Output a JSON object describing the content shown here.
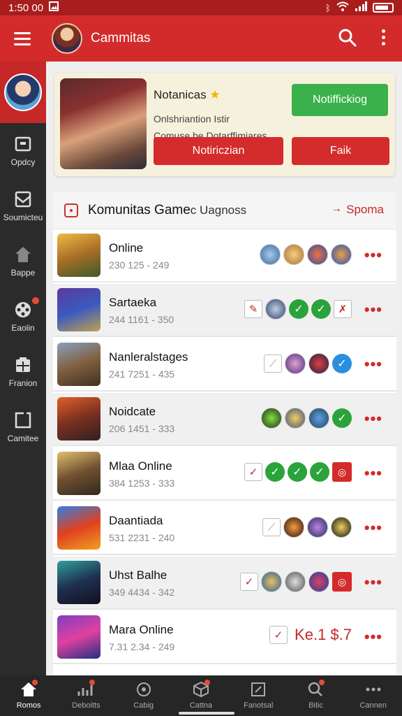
{
  "status": {
    "time": "1:50 00"
  },
  "appbar": {
    "title": "Cammitas"
  },
  "rail": [
    {
      "label": "Opdcy",
      "icon": "inbox-icon"
    },
    {
      "label": "Soumicteu",
      "icon": "envelope-icon"
    },
    {
      "label": "Bappe",
      "icon": "home-icon"
    },
    {
      "label": "Eaolin",
      "icon": "film-reel-icon"
    },
    {
      "label": "Franion",
      "icon": "grid-icon"
    },
    {
      "label": "Camitee",
      "icon": "square-icon"
    }
  ],
  "notification": {
    "title": "Notanicas",
    "line1": "Onlshriantion Istir",
    "line2": "Comuse be Dotarffimiares.",
    "primary_button": "Notiffickiog",
    "secondary_button": "Notiriczian",
    "tertiary_button": "Faik"
  },
  "community": {
    "title": "Komunitas Game",
    "subtitle": "c Uagnoss",
    "arrow": "→",
    "link": "Spoma"
  },
  "games": [
    {
      "name": "Online",
      "stats": "230 125 - 249"
    },
    {
      "name": "Sartaeka",
      "stats": "244 1161 - 350"
    },
    {
      "name": "Nanleralstages",
      "stats": "241 7251 - 435"
    },
    {
      "name": "Noidcate",
      "stats": "206 1451 - 333"
    },
    {
      "name": "Mlaa Online",
      "stats": "384 1253 - 333"
    },
    {
      "name": "Daantiada",
      "stats": "531 2231 - 240"
    },
    {
      "name": "Uhst Balhe",
      "stats": "349 4434 - 342"
    },
    {
      "name": "Mara Online",
      "stats": "7.31 2.34 - 249",
      "badge": "Ke.1 $.7"
    }
  ],
  "bottom_nav": [
    {
      "label": "Romos",
      "icon": "home-icon"
    },
    {
      "label": "Deboitts",
      "icon": "chart-icon"
    },
    {
      "label": "Cabig",
      "icon": "compass-icon"
    },
    {
      "label": "Cattna",
      "icon": "cube-icon"
    },
    {
      "label": "Fanotsal",
      "icon": "edit-square-icon"
    },
    {
      "label": "Bitic",
      "icon": "search-icon"
    },
    {
      "label": "Cannen",
      "icon": "more-icon"
    }
  ],
  "colors": {
    "primary": "#d32b2b",
    "status_bar": "#a81d1d",
    "success": "#2aa33b",
    "info": "#2b8fe0"
  }
}
